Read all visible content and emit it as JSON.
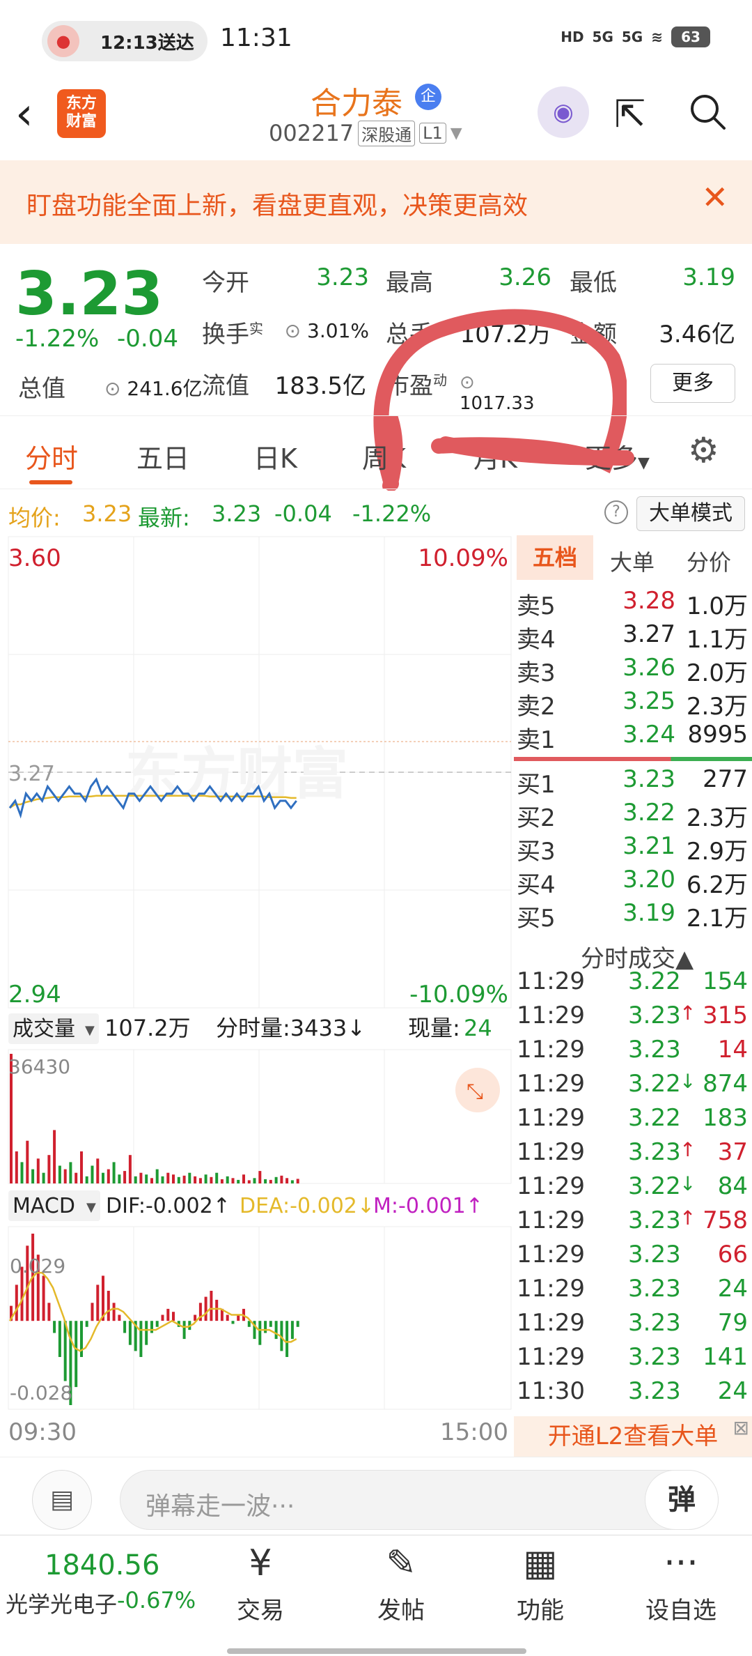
{
  "status_bar": {
    "delivery_text": "12:13送达",
    "time": "11:31",
    "network": "5G",
    "battery": "63"
  },
  "header": {
    "logo_text": "东方\n财富",
    "stock_name": "合力泰",
    "badge": "企",
    "stock_code": "002217",
    "tag_market": "深股通",
    "tag_level": "L1"
  },
  "banner": {
    "text": "盯盘功能全面上新，看盘更直观，决策更高效",
    "close": "✕"
  },
  "quote": {
    "price": "3.23",
    "change_pct": "-1.22%",
    "change": "-0.04",
    "total_value_label": "总值",
    "total_value": "241.6亿",
    "open_label": "今开",
    "open": "3.23",
    "high_label": "最高",
    "high": "3.26",
    "low_label": "最低",
    "low": "3.19",
    "turnover_label": "换手",
    "turnover_sup": "实",
    "turnover": "3.01%",
    "volume_label": "总手",
    "volume": "107.2万",
    "amount_label": "金额",
    "amount": "3.46亿",
    "float_label": "流值",
    "float_value": "183.5亿",
    "pe_label": "市盈",
    "pe_sup": "动",
    "pe": "1017.33",
    "more": "更多"
  },
  "tabs": [
    "分时",
    "五日",
    "日K",
    "周K",
    "月K",
    "更多"
  ],
  "avg_row": {
    "avg_label": "均价:",
    "avg": "3.23",
    "latest_label": "最新:",
    "latest": "3.23",
    "change": "-0.04",
    "pct": "-1.22%",
    "big_mode": "大单模式"
  },
  "chart": {
    "y_top": "3.60",
    "y_top_pct": "10.09%",
    "y_mid": "3.27",
    "y_bottom": "2.94",
    "y_bottom_pct": "-10.09%",
    "watermark": "东方财富",
    "vol_label": "成交量",
    "vol_total": "107.2万",
    "vol_tick": "分时量:3433↓",
    "vol_now_label": "现量:",
    "vol_now": "24",
    "vol_max": "36430",
    "macd_label": "MACD",
    "dif": "DIF:-0.002↑",
    "dea": "DEA:-0.002↓",
    "m": "M:-0.001↑",
    "macd_top": "0.029",
    "macd_bottom": "-0.028",
    "time_start": "09:30",
    "time_end": "15:00"
  },
  "chart_data": {
    "type": "line",
    "title": "",
    "xlabel": "",
    "ylabel": "",
    "ylim": [
      2.94,
      3.6
    ],
    "prev_close": 3.27,
    "price": [
      3.22,
      3.23,
      3.21,
      3.24,
      3.23,
      3.24,
      3.23,
      3.25,
      3.24,
      3.23,
      3.24,
      3.25,
      3.24,
      3.24,
      3.23,
      3.25,
      3.26,
      3.24,
      3.25,
      3.24,
      3.23,
      3.22,
      3.24,
      3.24,
      3.23,
      3.24,
      3.25,
      3.24,
      3.23,
      3.24,
      3.24,
      3.25,
      3.24,
      3.24,
      3.23,
      3.24,
      3.24,
      3.25,
      3.24,
      3.23,
      3.24,
      3.23,
      3.24,
      3.23,
      3.24,
      3.24,
      3.25,
      3.23,
      3.24,
      3.22,
      3.23,
      3.23,
      3.22,
      3.23
    ],
    "avg": [
      3.22,
      3.225,
      3.225,
      3.228,
      3.23,
      3.232,
      3.233,
      3.234,
      3.235,
      3.235,
      3.235,
      3.236,
      3.236,
      3.236,
      3.236,
      3.236,
      3.237,
      3.237,
      3.237,
      3.237,
      3.237,
      3.237,
      3.237,
      3.237,
      3.237,
      3.237,
      3.237,
      3.237,
      3.237,
      3.237,
      3.237,
      3.237,
      3.237,
      3.237,
      3.237,
      3.237,
      3.237,
      3.236,
      3.236,
      3.236,
      3.236,
      3.236,
      3.236,
      3.236,
      3.236,
      3.236,
      3.236,
      3.236,
      3.235,
      3.235,
      3.235,
      3.235,
      3.234,
      3.234
    ],
    "volume": [
      36430,
      9000,
      6000,
      12000,
      4000,
      7000,
      3000,
      8000,
      15000,
      5000,
      4000,
      6000,
      3000,
      9000,
      2000,
      5000,
      7000,
      3000,
      4000,
      6000,
      2500,
      3500,
      8000,
      2000,
      3000,
      2500,
      1500,
      4000,
      2000,
      3000,
      2500,
      1800,
      2200,
      3000,
      2000,
      1500,
      2500,
      1800,
      3000,
      1200,
      2000,
      1500,
      1000,
      2500,
      900,
      1500,
      3500,
      1200,
      1000,
      1800,
      2200,
      1500,
      900,
      1300
    ],
    "volume_up": [
      true,
      true,
      false,
      true,
      false,
      true,
      false,
      true,
      true,
      false,
      true,
      false,
      true,
      true,
      false,
      false,
      true,
      false,
      true,
      false,
      false,
      true,
      true,
      false,
      true,
      false,
      true,
      false,
      false,
      true,
      true,
      false,
      true,
      false,
      true,
      true,
      false,
      true,
      false,
      true,
      false,
      true,
      false,
      true,
      true,
      false,
      true,
      false,
      true,
      false,
      true,
      true,
      false,
      true
    ],
    "macd": [
      0.005,
      0.012,
      0.018,
      0.025,
      0.029,
      0.022,
      0.015,
      0.006,
      -0.004,
      -0.012,
      -0.02,
      -0.028,
      -0.022,
      -0.012,
      -0.002,
      0.006,
      0.012,
      0.015,
      0.01,
      0.006,
      0.002,
      -0.004,
      -0.008,
      -0.01,
      -0.012,
      -0.008,
      -0.004,
      -0.002,
      0.002,
      0.004,
      0.003,
      -0.002,
      -0.006,
      -0.003,
      0.002,
      0.006,
      0.008,
      0.01,
      0.007,
      0.004,
      0.002,
      -0.001,
      0.002,
      0.004,
      -0.002,
      -0.006,
      -0.008,
      -0.004,
      -0.002,
      -0.006,
      -0.01,
      -0.012,
      -0.006,
      -0.002
    ],
    "dea": [
      0.0,
      0.003,
      0.006,
      0.01,
      0.014,
      0.016,
      0.016,
      0.014,
      0.011,
      0.006,
      0.001,
      -0.005,
      -0.009,
      -0.01,
      -0.009,
      -0.006,
      -0.002,
      0.001,
      0.003,
      0.004,
      0.004,
      0.003,
      0.001,
      -0.001,
      -0.003,
      -0.003,
      -0.003,
      -0.003,
      -0.002,
      -0.001,
      0.0,
      -0.001,
      -0.002,
      -0.002,
      -0.001,
      0.001,
      0.002,
      0.004,
      0.004,
      0.004,
      0.003,
      0.002,
      0.002,
      0.002,
      0.001,
      -0.001,
      -0.003,
      -0.003,
      -0.003,
      -0.004,
      -0.005,
      -0.007,
      -0.007,
      -0.006
    ],
    "macd_ylim": [
      -0.028,
      0.029
    ]
  },
  "order_book": {
    "tabs": [
      "五档",
      "大单",
      "分价"
    ],
    "asks": [
      {
        "label": "卖5",
        "price": "3.28",
        "vol": "1.0万",
        "color": "red"
      },
      {
        "label": "卖4",
        "price": "3.27",
        "vol": "1.1万",
        "color": "dark"
      },
      {
        "label": "卖3",
        "price": "3.26",
        "vol": "2.0万",
        "color": "green"
      },
      {
        "label": "卖2",
        "price": "3.25",
        "vol": "2.3万",
        "color": "green"
      },
      {
        "label": "卖1",
        "price": "3.24",
        "vol": "8995",
        "color": "green"
      }
    ],
    "bids": [
      {
        "label": "买1",
        "price": "3.23",
        "vol": "277",
        "color": "green"
      },
      {
        "label": "买2",
        "price": "3.22",
        "vol": "2.3万",
        "color": "green"
      },
      {
        "label": "买3",
        "price": "3.21",
        "vol": "2.9万",
        "color": "green"
      },
      {
        "label": "买4",
        "price": "3.20",
        "vol": "6.2万",
        "color": "green"
      },
      {
        "label": "买5",
        "price": "3.19",
        "vol": "2.1万",
        "color": "green"
      }
    ],
    "ticks_title": "分时成交▲",
    "ticks": [
      {
        "time": "11:29",
        "price": "3.22",
        "arrow": "",
        "vol": "154",
        "vcolor": "green"
      },
      {
        "time": "11:29",
        "price": "3.23",
        "arrow": "↑",
        "vol": "315",
        "vcolor": "red"
      },
      {
        "time": "11:29",
        "price": "3.23",
        "arrow": "",
        "vol": "14",
        "vcolor": "red"
      },
      {
        "time": "11:29",
        "price": "3.22",
        "arrow": "↓",
        "vol": "874",
        "vcolor": "green"
      },
      {
        "time": "11:29",
        "price": "3.22",
        "arrow": "",
        "vol": "183",
        "vcolor": "green"
      },
      {
        "time": "11:29",
        "price": "3.23",
        "arrow": "↑",
        "vol": "37",
        "vcolor": "red"
      },
      {
        "time": "11:29",
        "price": "3.22",
        "arrow": "↓",
        "vol": "84",
        "vcolor": "green"
      },
      {
        "time": "11:29",
        "price": "3.23",
        "arrow": "↑",
        "vol": "758",
        "vcolor": "red"
      },
      {
        "time": "11:29",
        "price": "3.23",
        "arrow": "",
        "vol": "66",
        "vcolor": "red"
      },
      {
        "time": "11:29",
        "price": "3.23",
        "arrow": "",
        "vol": "24",
        "vcolor": "green"
      },
      {
        "time": "11:29",
        "price": "3.23",
        "arrow": "",
        "vol": "79",
        "vcolor": "green"
      },
      {
        "time": "11:29",
        "price": "3.23",
        "arrow": "",
        "vol": "141",
        "vcolor": "green"
      },
      {
        "time": "11:30",
        "price": "3.23",
        "arrow": "",
        "vol": "24",
        "vcolor": "green"
      }
    ],
    "l2_text": "开通L2查看大单"
  },
  "danmu": {
    "placeholder": "弹幕走一波···",
    "button": "弹"
  },
  "bottom_nav": {
    "index_value": "1840.56",
    "index_name": "光学光电子",
    "index_pct": "-0.67%",
    "items": [
      {
        "label": "交易",
        "icon": "¥"
      },
      {
        "label": "发帖",
        "icon": "✎"
      },
      {
        "label": "功能",
        "icon": "▦"
      },
      {
        "label": "设自选",
        "icon": "···"
      }
    ]
  },
  "colors": {
    "up": "#d0202e",
    "down": "#1d9a33",
    "accent": "#e8561c",
    "price_line": "#2f6fc0",
    "avg_line": "#e4b92a"
  }
}
